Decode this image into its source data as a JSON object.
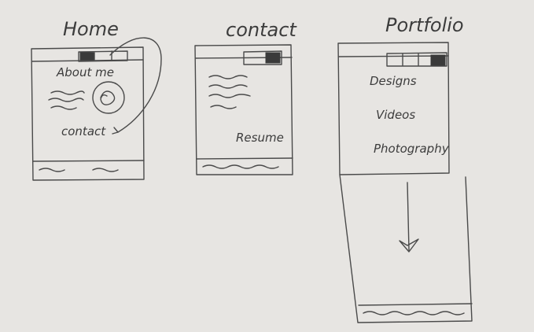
{
  "sketches": [
    {
      "title": "Home",
      "items": [
        "About me",
        "contact"
      ]
    },
    {
      "title": "contact",
      "items": [
        "Resume"
      ]
    },
    {
      "title": "Portfolio",
      "items": [
        "Designs",
        "Videos",
        "Photography"
      ]
    }
  ],
  "colors": {
    "paper": "#e7e5e2",
    "pencil": "#4a4a4a"
  }
}
